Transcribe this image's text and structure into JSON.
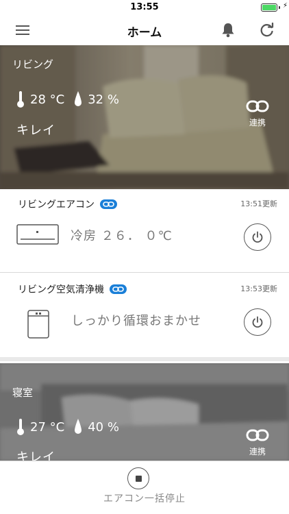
{
  "status_bar": {
    "time": "13:55"
  },
  "header": {
    "title": "ホーム",
    "menu_icon": "hamburger-menu-icon",
    "bell_icon": "bell-icon",
    "refresh_icon": "refresh-icon"
  },
  "rooms": [
    {
      "name": "リビング",
      "temperature": "28 °C",
      "humidity": "32 %",
      "air_quality": "キレイ",
      "link_label": "連携",
      "devices": [
        {
          "name": "リビングエアコン",
          "updated": "13:51更新",
          "state": "冷房 ２６． ０℃",
          "icon": "air-conditioner-icon"
        },
        {
          "name": "リビング空気清浄機",
          "updated": "13:53更新",
          "state": "しっかり循環おまかせ",
          "icon": "air-purifier-icon"
        }
      ]
    },
    {
      "name": "寝室",
      "temperature": "27 °C",
      "humidity": "40 %",
      "air_quality": "キレイ",
      "link_label": "連携"
    }
  ],
  "bottom_bar": {
    "stop_all_label": "エアコン一括停止"
  },
  "colors": {
    "accent": "#1a7fd8",
    "battery": "#4cd964",
    "overlay": "#000000"
  }
}
